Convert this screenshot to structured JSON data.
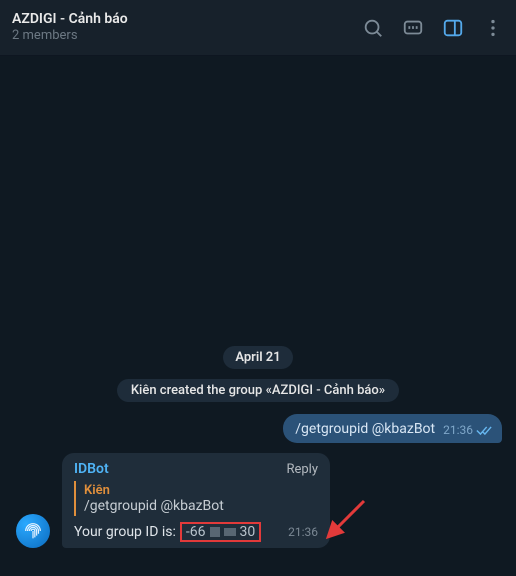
{
  "header": {
    "title": "AZDIGI - Cảnh báo",
    "subtitle": "2 members"
  },
  "date_chip": "April 21",
  "system_message": "Kiên created the group «AZDIGI - Cảnh báo»",
  "outgoing": {
    "text": "/getgroupid @kbazBot",
    "time": "21:36"
  },
  "incoming": {
    "sender": "IDBot",
    "reply_label": "Reply",
    "quote_name": "Kiên",
    "quote_text": "/getgroupid @kbazBot",
    "body_prefix": "Your group ID is:",
    "gid_left": "-66",
    "gid_right": "30",
    "time": "21:36"
  }
}
